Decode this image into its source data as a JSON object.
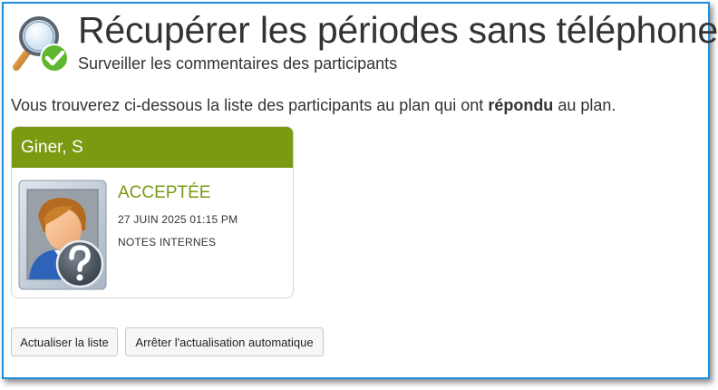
{
  "header": {
    "title": "Récupérer les périodes sans téléphone",
    "subtitle": "Surveiller les commentaires des participants",
    "icon": "magnifier-check-icon"
  },
  "intro": {
    "before": "Vous trouverez ci-dessous la liste des participants au plan qui ont ",
    "bold": "répondu",
    "after": " au plan."
  },
  "participants": [
    {
      "name": "Giner, S",
      "status": "ACCEPTÉE",
      "date": "27 JUIN 2025 01:15 PM",
      "notes_label": "NOTES INTERNES",
      "avatar": "unknown-user-icon"
    }
  ],
  "actions": {
    "refresh_label": "Actualiser la liste",
    "stop_auto_label": "Arrêter l'actualisation automatique"
  },
  "colors": {
    "accent_green": "#7b9a12",
    "frame_blue": "#1c8fdc",
    "text": "#333333"
  }
}
